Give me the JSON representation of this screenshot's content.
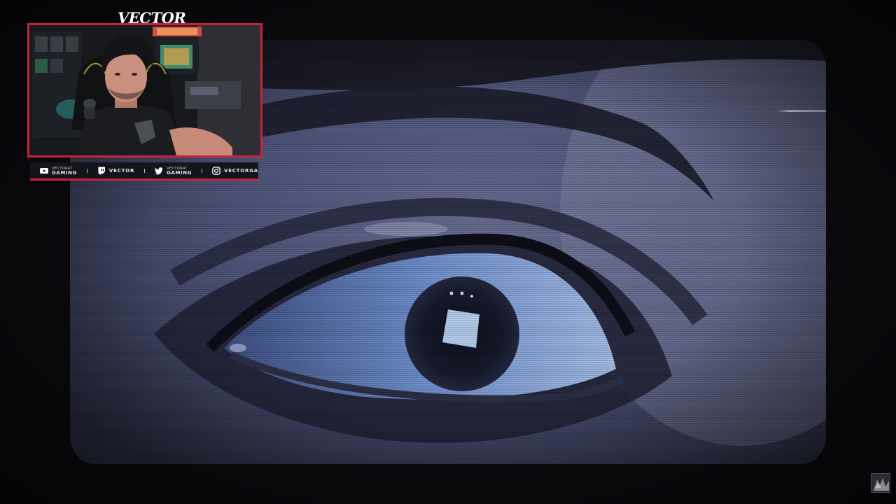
{
  "overlay": {
    "streamer_name": "VECTOR",
    "accent_color": "#c8223a"
  },
  "socials": [
    {
      "icon": "youtube-icon",
      "line1": "VECTORAT",
      "line2": "GAMING"
    },
    {
      "icon": "twitch-icon",
      "line1": "VECTOR"
    },
    {
      "icon": "twitter-icon",
      "line1": "VECTORAT",
      "line2": "GAMING"
    },
    {
      "icon": "instagram-icon",
      "line1": "VECTORGA"
    }
  ]
}
